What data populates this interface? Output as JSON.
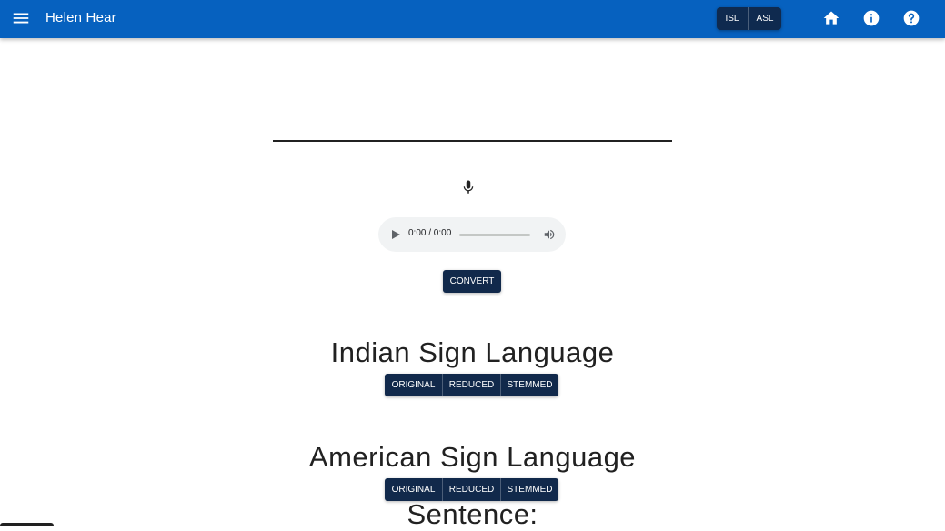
{
  "app": {
    "title": "Helen Hear"
  },
  "header": {
    "language_toggle": [
      "ISL",
      "ASL"
    ],
    "icons": [
      "menu-icon",
      "home-icon",
      "info-icon",
      "help-icon"
    ]
  },
  "input": {
    "value": "",
    "placeholder": ""
  },
  "audio_player": {
    "time": "0:00 / 0:00"
  },
  "convert_label": "CONVERT",
  "sections": [
    {
      "title": "Indian Sign Language",
      "buttons": [
        "ORIGINAL",
        "REDUCED",
        "STEMMED"
      ]
    },
    {
      "title": "American Sign Language",
      "buttons": [
        "ORIGINAL",
        "REDUCED",
        "STEMMED"
      ]
    }
  ],
  "sentence_label": "Sentence:",
  "colors": {
    "appbar": "#0661bf",
    "button": "#11294b",
    "text": "#212121"
  }
}
